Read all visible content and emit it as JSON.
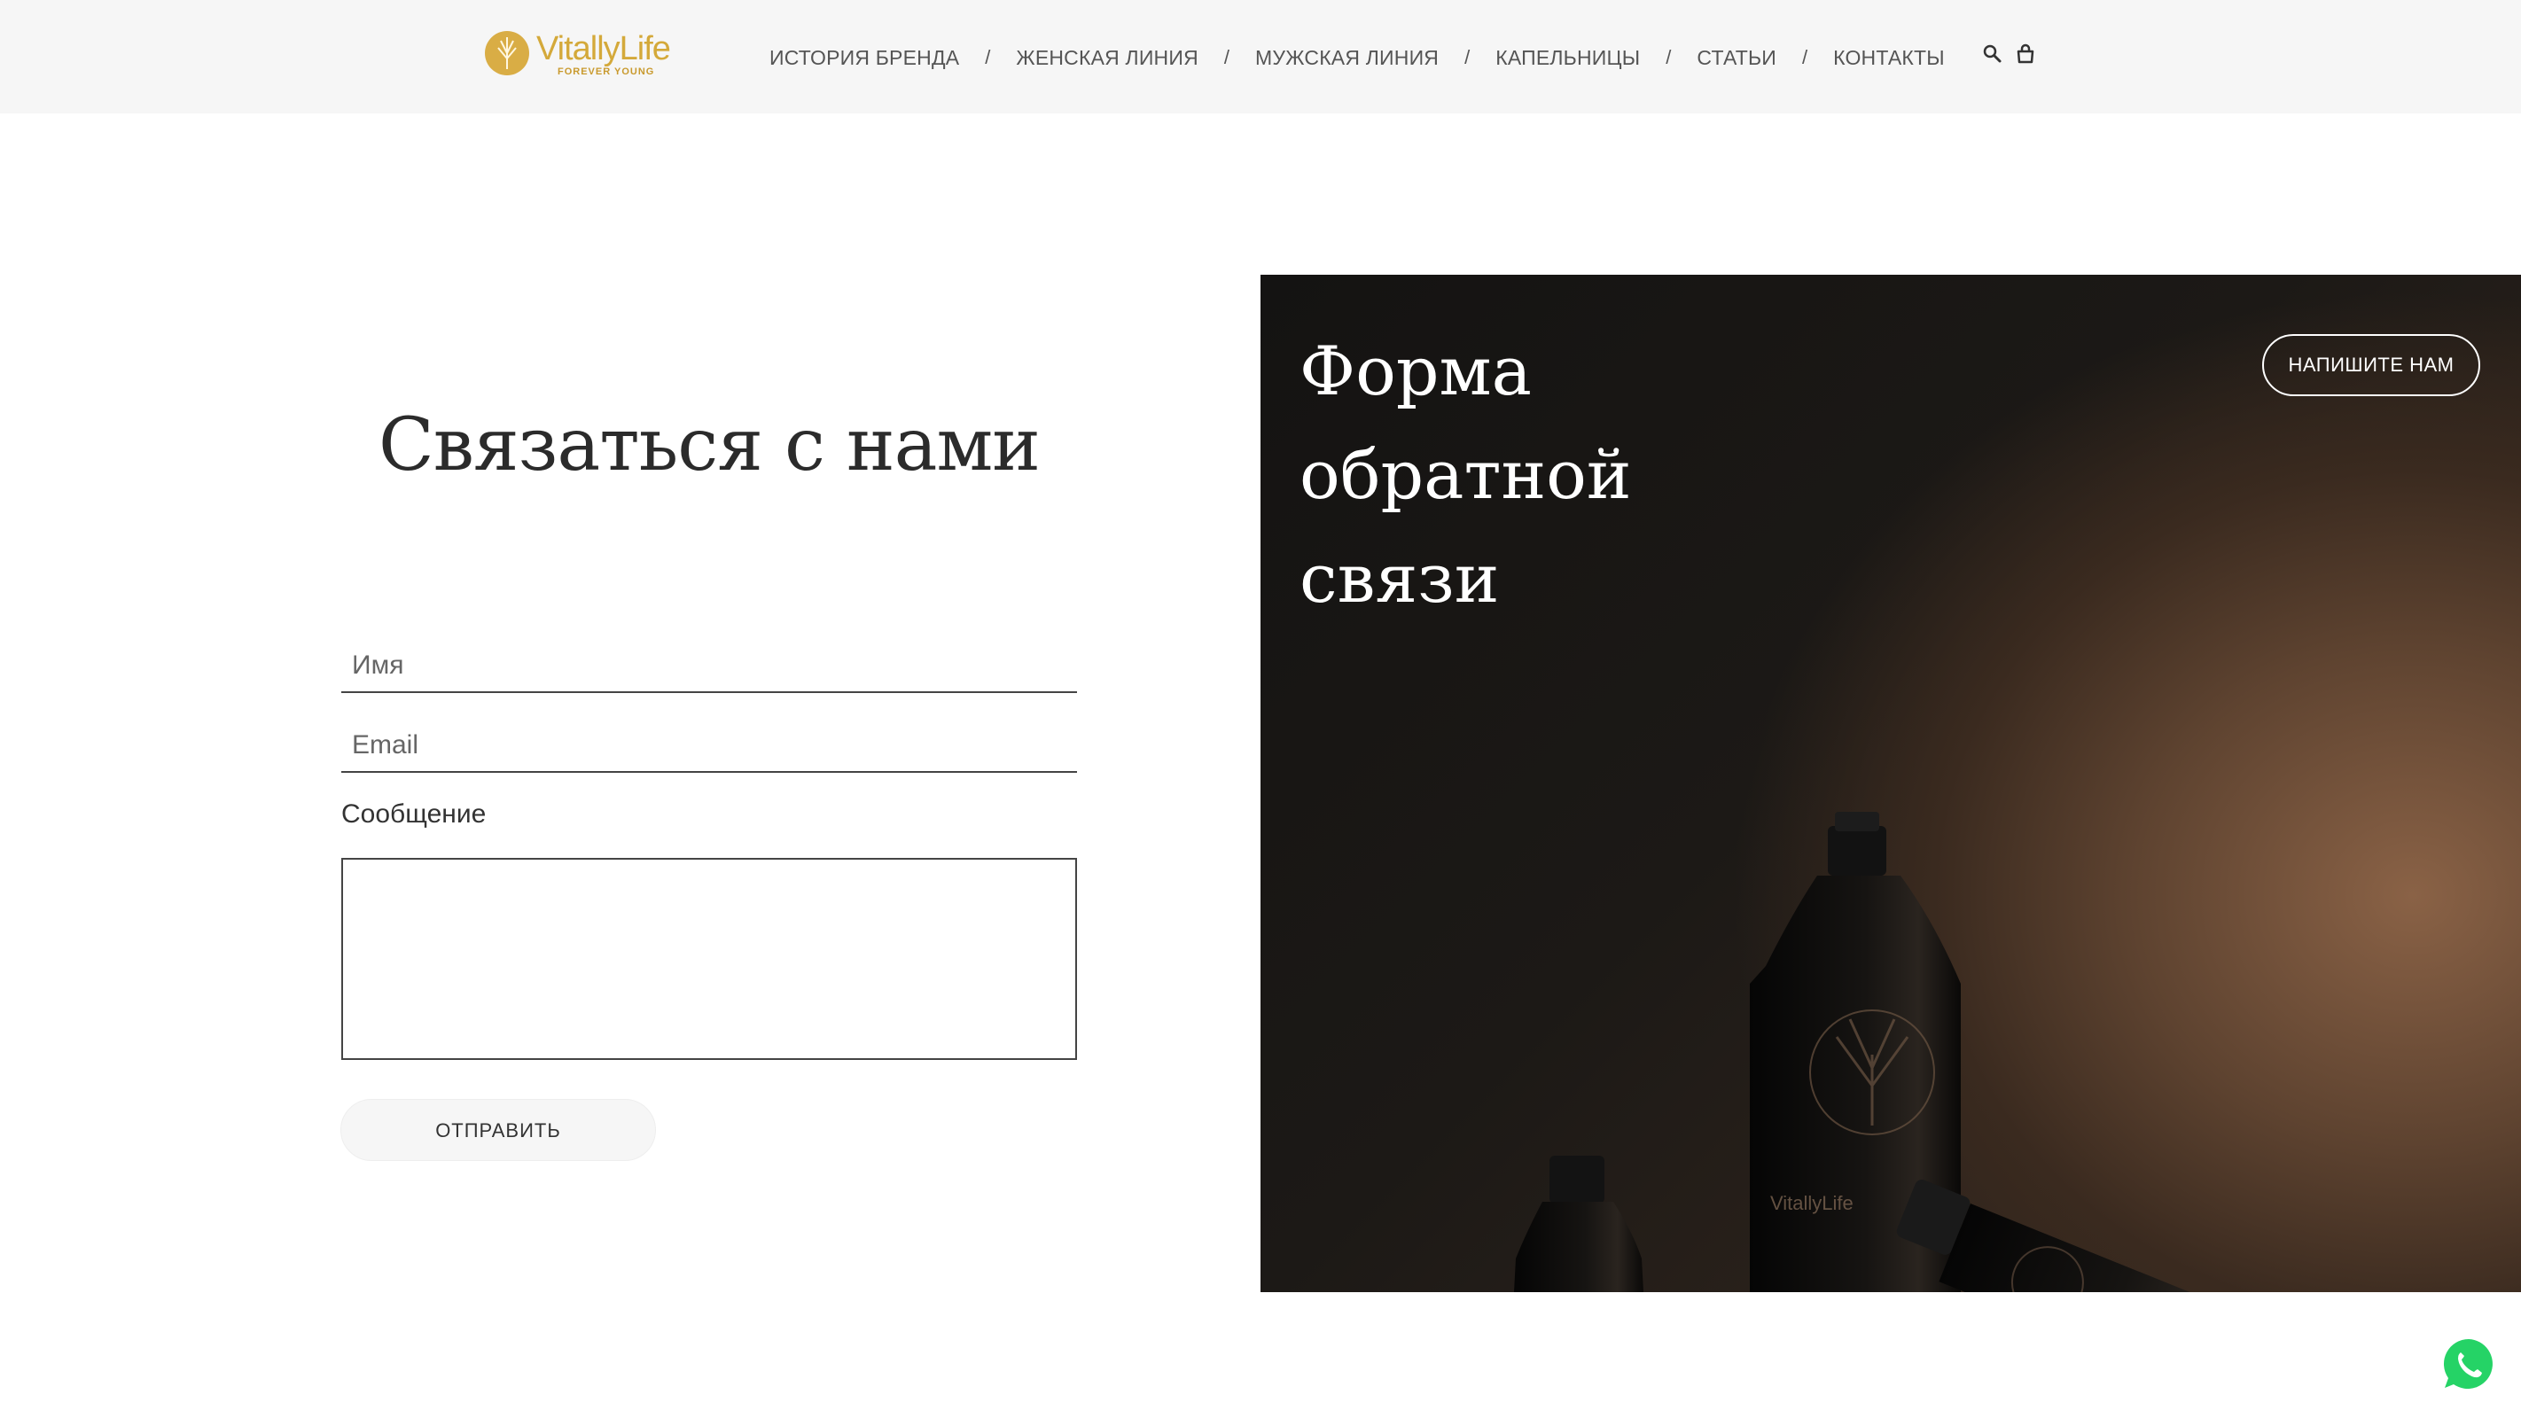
{
  "header": {
    "logo": {
      "name": "VitallyLife",
      "tagline": "FOREVER YOUNG"
    },
    "nav": [
      {
        "label": "ИСТОРИЯ БРЕНДА"
      },
      {
        "label": "ЖЕНСКАЯ ЛИНИЯ"
      },
      {
        "label": "МУЖСКАЯ ЛИНИЯ"
      },
      {
        "label": "КАПЕЛЬНИЦЫ"
      },
      {
        "label": "СТАТЬИ"
      },
      {
        "label": "КОНТАКТЫ"
      }
    ],
    "separator": "/",
    "icons": {
      "search": "search-icon",
      "cart": "shopping-bag-icon"
    }
  },
  "contact": {
    "title": "Связаться с нами",
    "name_placeholder": "Имя",
    "email_placeholder": "Email",
    "message_label": "Сообщение",
    "submit_label": "ОТПРАВИТЬ"
  },
  "hero": {
    "title_line1": "Форма",
    "title_line2": "обратной",
    "title_line3": "связи",
    "button_label": "НАПИШИТЕ НАМ"
  },
  "colors": {
    "brand_gold": "#d4a93a",
    "header_bg": "#f6f6f6",
    "whatsapp_green": "#25d366"
  }
}
